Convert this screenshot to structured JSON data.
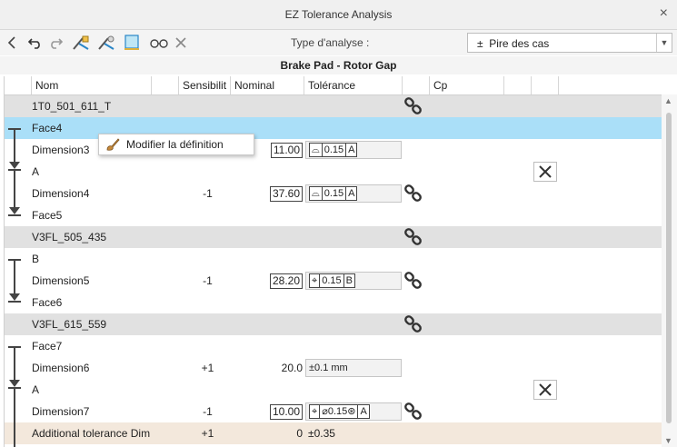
{
  "window": {
    "title": "EZ Tolerance Analysis",
    "close_glyph": "×"
  },
  "toolbar": {
    "analysis_label": "Type d'analyse :",
    "analysis_value": "Pire des cas",
    "analysis_prefix": "±"
  },
  "subtitle": "Brake Pad - Rotor Gap",
  "columns": {
    "nom": "Nom",
    "sens": "Sensibilit",
    "nominal": "Nominal",
    "tol": "Tolérance",
    "cp": "Cp"
  },
  "rows": [
    {
      "kind": "group",
      "nom": "1T0_501_611_T"
    },
    {
      "kind": "sel",
      "nom": "Face4"
    },
    {
      "kind": "dim",
      "nom": "Dimension3",
      "sens": "",
      "nominal": "11.00",
      "tol_sym": "⌓",
      "tol_val": "0.15",
      "tol_ref": "A"
    },
    {
      "kind": "plain",
      "nom": "A"
    },
    {
      "kind": "dim",
      "nom": "Dimension4",
      "sens": "-1",
      "nominal": "37.60",
      "tol_sym": "⌓",
      "tol_val": "0.15",
      "tol_ref": "A"
    },
    {
      "kind": "plain",
      "nom": "Face5"
    },
    {
      "kind": "group",
      "nom": "V3FL_505_435"
    },
    {
      "kind": "plain",
      "nom": "B"
    },
    {
      "kind": "dim",
      "nom": "Dimension5",
      "sens": "-1",
      "nominal": "28.20",
      "tol_sym": "⌖",
      "tol_val": "0.15",
      "tol_ref": "B"
    },
    {
      "kind": "plain",
      "nom": "Face6"
    },
    {
      "kind": "group",
      "nom": "V3FL_615_559"
    },
    {
      "kind": "plain",
      "nom": "Face7"
    },
    {
      "kind": "dim2",
      "nom": "Dimension6",
      "sens": "+1",
      "nominal": "20.0",
      "tol_text": "±0.1 mm"
    },
    {
      "kind": "plain",
      "nom": "A"
    },
    {
      "kind": "dim",
      "nom": "Dimension7",
      "sens": "-1",
      "nominal": "10.00",
      "tol_sym": "⌖",
      "tol_val": "⌀0.15⊛",
      "tol_ref": "A"
    },
    {
      "kind": "addl",
      "nom": "Additional tolerance Dim",
      "sens": "+1",
      "nominal": "0",
      "tol_text": "±0.35"
    }
  ],
  "context_menu": {
    "item": "Modifier la définition"
  },
  "colors": {
    "selected": "#aadff8",
    "group": "#e1e1e1",
    "additional": "#f3e8dc"
  }
}
